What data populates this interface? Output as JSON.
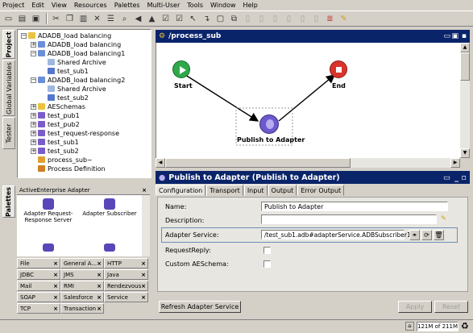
{
  "menu": [
    "Project",
    "Edit",
    "View",
    "Resources",
    "Palettes",
    "Multi-User",
    "Tools",
    "Window",
    "Help"
  ],
  "side_tabs": [
    "Project",
    "Global Variables",
    "Tester",
    "Palettes"
  ],
  "tree": [
    {
      "label": "ADADB_load balancing",
      "level": 0,
      "expander": "−",
      "icon": "folder-icon"
    },
    {
      "label": "ADADB_load balancing",
      "level": 1,
      "expander": "+",
      "icon": "adapter-instance-icon"
    },
    {
      "label": "ADADB_load balancing1",
      "level": 1,
      "expander": "−",
      "icon": "adapter-instance-icon"
    },
    {
      "label": "Shared Archive",
      "level": 2,
      "expander": "",
      "icon": "shared-archive-icon"
    },
    {
      "label": "test_sub1",
      "level": 2,
      "expander": "",
      "icon": "service-icon"
    },
    {
      "label": "ADADB_load balancing2",
      "level": 1,
      "expander": "−",
      "icon": "adapter-instance-icon"
    },
    {
      "label": "Shared Archive",
      "level": 2,
      "expander": "",
      "icon": "shared-archive-icon"
    },
    {
      "label": "test_sub2",
      "level": 2,
      "expander": "",
      "icon": "service-icon"
    },
    {
      "label": "AESchemas",
      "level": 1,
      "expander": "+",
      "icon": "folder-icon"
    },
    {
      "label": "test_pub1",
      "level": 1,
      "expander": "+",
      "icon": "process-folder-icon"
    },
    {
      "label": "test_pub2",
      "level": 1,
      "expander": "+",
      "icon": "process-folder-icon"
    },
    {
      "label": "test_request-response",
      "level": 1,
      "expander": "+",
      "icon": "process-folder-icon"
    },
    {
      "label": "test_sub1",
      "level": 1,
      "expander": "+",
      "icon": "process-folder-icon"
    },
    {
      "label": "test_sub2",
      "level": 1,
      "expander": "+",
      "icon": "process-folder-icon"
    },
    {
      "label": "process_sub~",
      "level": 1,
      "expander": "",
      "icon": "process-icon"
    },
    {
      "label": "Process Definition",
      "level": 1,
      "expander": "",
      "icon": "process-definition-icon"
    }
  ],
  "palette": {
    "header": "ActiveEnterprise Adapter",
    "items": [
      "Adapter Request-Response Server",
      "Adapter Subscriber"
    ],
    "tabs": [
      "File",
      "General A...",
      "HTTP",
      "JDBC",
      "JMS",
      "Java",
      "Mail",
      "RMI",
      "Rendezvous",
      "SOAP",
      "Salesforce",
      "Service",
      "TCP",
      "Transaction"
    ]
  },
  "process": {
    "title": "/process_sub",
    "nodes": {
      "start": "Start",
      "end": "End",
      "activity": "Publish to Adapter"
    }
  },
  "properties": {
    "title": "Publish to Adapter (Publish to Adapter)",
    "tabs": [
      "Configuration",
      "Transport",
      "Input",
      "Output",
      "Error Output"
    ],
    "fields": {
      "name_label": "Name:",
      "name_value": "Publish to Adapter",
      "description_label": "Description:",
      "description_value": "",
      "adapter_service_label": "Adapter Service:",
      "adapter_service_value": "/test_sub1.adb#adapterService.ADBSubscriber1",
      "request_reply_label": "RequestReply:",
      "custom_schema_label": "Custom AESchema:"
    },
    "refresh_button": "Refresh Adapter Service",
    "apply_button": "Apply",
    "reset_button": "Reset"
  },
  "status": {
    "memory": "121M of 211M"
  }
}
